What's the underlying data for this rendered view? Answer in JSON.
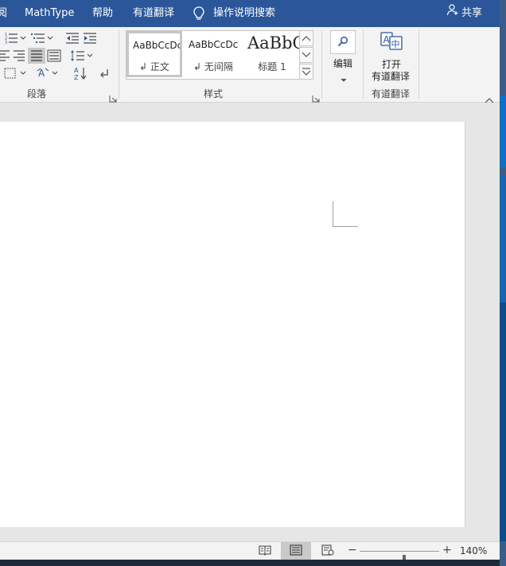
{
  "tabs": {
    "partial": "阅",
    "mathtype": "MathType",
    "help": "帮助",
    "youdao": "有道翻译",
    "tell_me": "操作说明搜索"
  },
  "share": {
    "label": "共享"
  },
  "ribbon": {
    "paragraph": {
      "label": "段落"
    },
    "styles": {
      "label": "样式",
      "items": [
        {
          "sample": "AaBbCcDc",
          "name": "正文",
          "selected": true
        },
        {
          "sample": "AaBbCcDc",
          "name": "无间隔",
          "selected": false
        },
        {
          "sample": "AaBbC",
          "name": "标题 1",
          "selected": false
        }
      ]
    },
    "editing": {
      "label": "编辑"
    },
    "youdao": {
      "open_label": "打开",
      "open_label2": "有道翻译",
      "group_label": "有道翻译"
    }
  },
  "status": {
    "zoom": "140%",
    "zoom_fraction": 0.56,
    "active_view": "print-layout"
  },
  "colors": {
    "title_bar": "#2b579a",
    "ribbon": "#f3f3f3",
    "canvas": "#e6e6e6",
    "page": "#ffffff"
  }
}
